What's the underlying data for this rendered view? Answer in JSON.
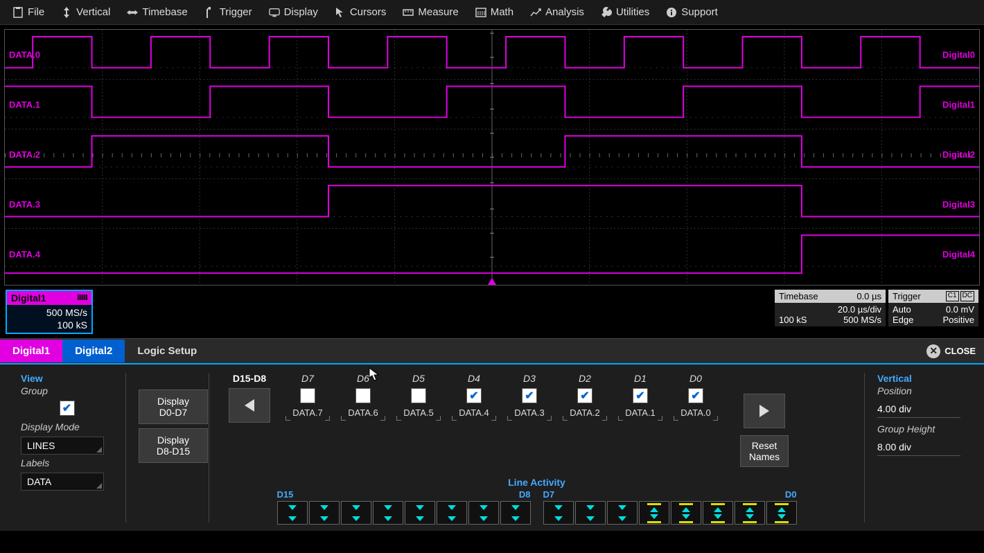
{
  "menu": [
    {
      "label": "File",
      "icon": "clipboard"
    },
    {
      "label": "Vertical",
      "icon": "vert"
    },
    {
      "label": "Timebase",
      "icon": "horiz"
    },
    {
      "label": "Trigger",
      "icon": "trigger"
    },
    {
      "label": "Display",
      "icon": "display"
    },
    {
      "label": "Cursors",
      "icon": "cursor"
    },
    {
      "label": "Measure",
      "icon": "measure"
    },
    {
      "label": "Math",
      "icon": "math"
    },
    {
      "label": "Analysis",
      "icon": "analysis"
    },
    {
      "label": "Utilities",
      "icon": "utilities"
    },
    {
      "label": "Support",
      "icon": "support"
    }
  ],
  "channels": [
    {
      "left": "DATA.0",
      "right": "Digital0"
    },
    {
      "left": "DATA.1",
      "right": "Digital1"
    },
    {
      "left": "DATA.2",
      "right": "Digital2"
    },
    {
      "left": "DATA.3",
      "right": "Digital3"
    },
    {
      "left": "DATA.4",
      "right": "Digital4"
    }
  ],
  "digital_badge": {
    "title": "Digital1",
    "rate": "500 MS/s",
    "samples": "100 kS"
  },
  "timebase": {
    "title": "Timebase",
    "pos": "0.0 µs",
    "div": "20.0 µs/div",
    "ks": "100 kS",
    "rate": "500 MS/s"
  },
  "trigger": {
    "title": "Trigger",
    "src": "C1",
    "coup": "DC",
    "mode": "Auto",
    "level": "0.0 mV",
    "type": "Edge",
    "slope": "Positive"
  },
  "tabs": {
    "t1": "Digital1",
    "t2": "Digital2",
    "t3": "Logic Setup",
    "close": "CLOSE"
  },
  "view": {
    "title": "View",
    "group": "Group",
    "display_mode": "Display Mode",
    "lines": "LINES",
    "labels_label": "Labels",
    "data": "DATA"
  },
  "display_buttons": {
    "d07": "Display\nD0-D7",
    "d815": "Display\nD8-D15"
  },
  "range": {
    "label": "D15-D8"
  },
  "bits": [
    {
      "id": "D7",
      "name": "DATA.7",
      "checked": false
    },
    {
      "id": "D6",
      "name": "DATA.6",
      "checked": false
    },
    {
      "id": "D5",
      "name": "DATA.5",
      "checked": false
    },
    {
      "id": "D4",
      "name": "DATA.4",
      "checked": true
    },
    {
      "id": "D3",
      "name": "DATA.3",
      "checked": true
    },
    {
      "id": "D2",
      "name": "DATA.2",
      "checked": true
    },
    {
      "id": "D1",
      "name": "DATA.1",
      "checked": true
    },
    {
      "id": "D0",
      "name": "DATA.0",
      "checked": true
    }
  ],
  "reset": "Reset\nNames",
  "vertical": {
    "title": "Vertical",
    "position_label": "Position",
    "position": "4.00 div",
    "height_label": "Group Height",
    "height": "8.00 div"
  },
  "line_activity": {
    "title": "Line Activity",
    "left": "D15",
    "mid_l": "D8",
    "mid_r": "D7",
    "right": "D0"
  }
}
